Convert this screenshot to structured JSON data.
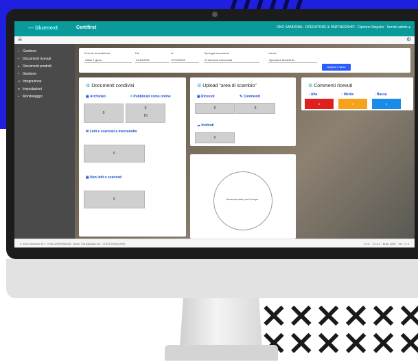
{
  "colors": {
    "topbar": "#0a9a9a",
    "accent_blue": "#1f1fe0",
    "red": "#e0201e",
    "orange": "#f7a21b",
    "blue": "#1a8be8"
  },
  "app": {
    "logo_prefix": "—",
    "logo": "bluenext",
    "title": "Certifirst",
    "header_right": "RNO SANDONA - OPERATORE & PARTNERSHIP - Cipriano Stepeko",
    "header_user": "Servizi admin"
  },
  "sidebar": {
    "items": [
      {
        "label": "Gestione",
        "icon": "home-icon"
      },
      {
        "label": "Documenti ricevuti",
        "icon": "inbox-icon"
      },
      {
        "label": "Documenti prodotti",
        "icon": "send-icon"
      },
      {
        "label": "Gestione",
        "icon": "settings-icon"
      },
      {
        "label": "Integrazione",
        "icon": "link-icon"
      },
      {
        "label": "Impostazioni",
        "icon": "gear-icon"
      },
      {
        "label": "Monitoraggio",
        "icon": "chart-icon"
      }
    ]
  },
  "filter": {
    "period_label": "Periodo di analisi/ora",
    "period_value": "Ultimi 7 giorni",
    "dal_label": "Dal",
    "dal_value": "01/10/2021",
    "al_label": "Al",
    "al_value": "07/10/2021",
    "tipo_label": "Tipologia documento",
    "tipo_value": "Di elementi selezionati",
    "utente_label": "Utente",
    "utente_value": "Operatore Modelli Av",
    "apply_label": "Applica e salva"
  },
  "cards": {
    "documenti": {
      "title": "Documenti condivisi",
      "inviati_label": "Archiviati",
      "inviati_value": "0",
      "pubblicati_label": "Pubblicati come online",
      "pubblicati_value": "0",
      "pubblicati_sub": "16",
      "letti_label": "Letti e scaricati a mezzanotte",
      "letti_value": "0",
      "non_letti_label": "Non letti o scaricati",
      "non_letti_value": "0"
    },
    "upload": {
      "title": "Upload \"area di scambio\"",
      "ricevuti_label": "Ricevuti",
      "ricevuti_value": "0",
      "commenti_label": "Commenti",
      "commenti_value": "0",
      "inoltrati_label": "Inoltrati",
      "inoltrati_value": "0"
    },
    "commenti": {
      "title": "Commenti ricevuti",
      "alta_label": "Alta",
      "alta_value": "0",
      "media_label": "Media",
      "media_value": "0",
      "bassa_label": "Bassa",
      "bassa_value": "0"
    },
    "chart_empty": {
      "text": "Nessuna dato per il tempo"
    }
  },
  "status": {
    "left": "© 2021 Bluenext Srl - P.IVA 02999990345 - Sede: Via Bassano 53 - 47921 Rimini (RN)",
    "right": "CVS · 1.0.0.4 · Build 2020 · Ver. 77.0"
  }
}
